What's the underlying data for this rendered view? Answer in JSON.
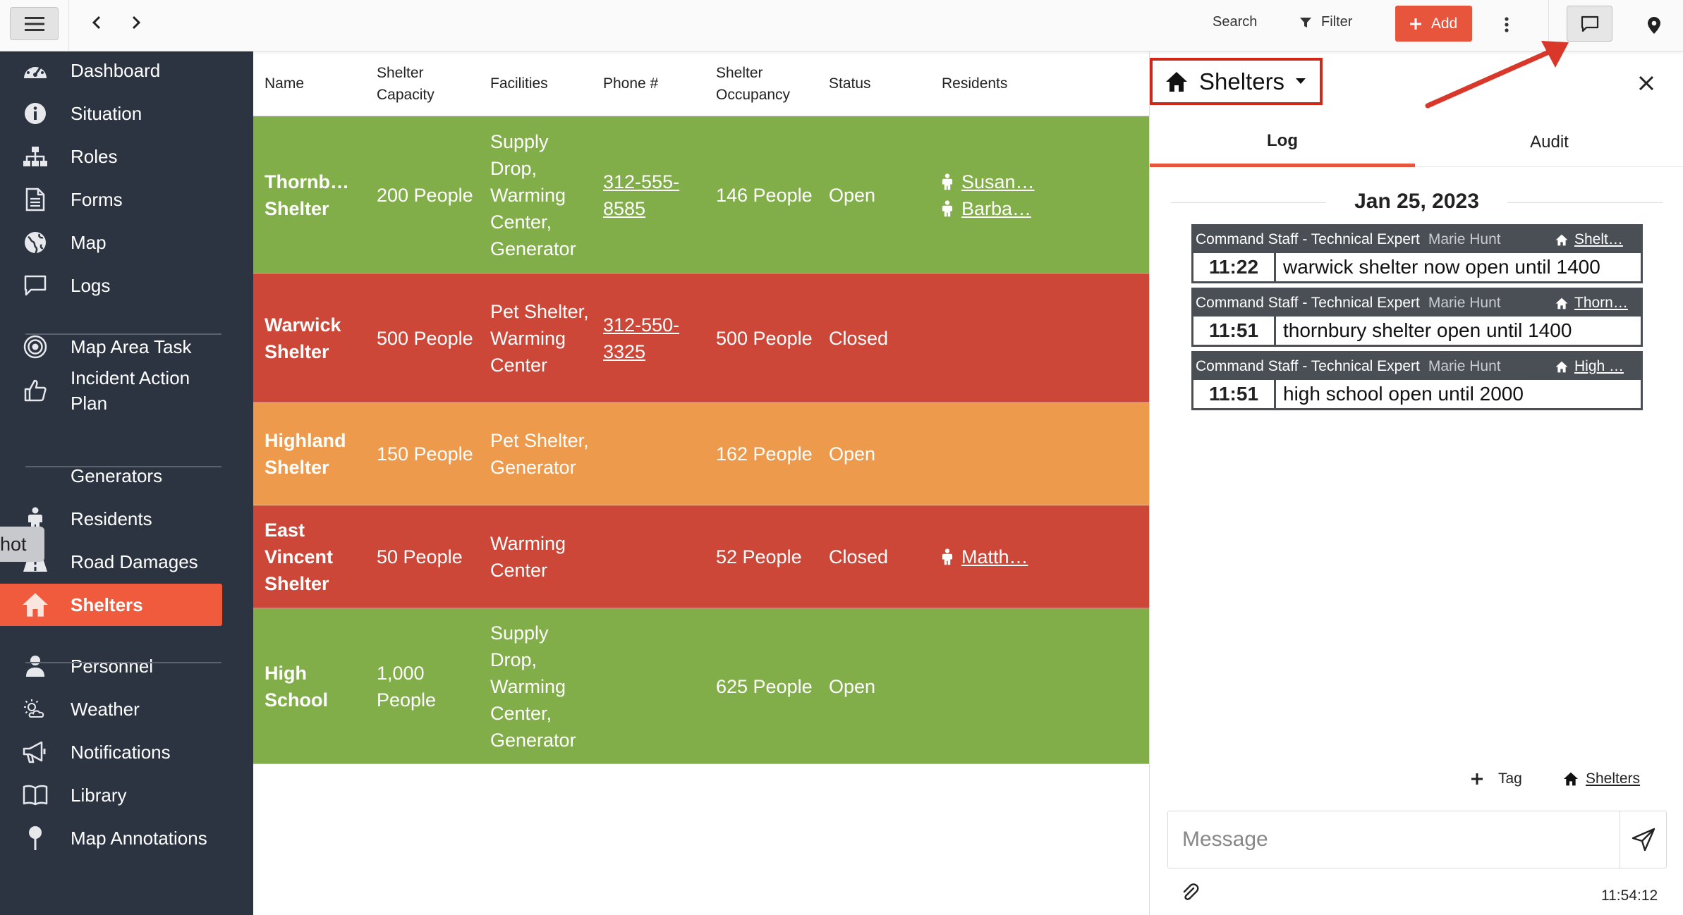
{
  "topbar": {
    "search_label": "Search",
    "filter_label": "Filter",
    "add_label": "Add"
  },
  "sidebar": {
    "items": [
      {
        "label": "Dashboard",
        "icon": "dashboard-icon"
      },
      {
        "label": "Situation",
        "icon": "info-icon"
      },
      {
        "label": "Roles",
        "icon": "org-chart-icon"
      },
      {
        "label": "Forms",
        "icon": "document-icon"
      },
      {
        "label": "Map",
        "icon": "globe-icon"
      },
      {
        "label": "Logs",
        "icon": "chat-icon"
      },
      {
        "label": "Map Area Task",
        "icon": "target-icon"
      },
      {
        "label": "Incident Action Plan",
        "icon": "thumbs-up-icon"
      },
      {
        "label": "Generators",
        "icon": "generator-icon"
      },
      {
        "label": "Residents",
        "icon": "person-icon"
      },
      {
        "label": "Road Damages",
        "icon": "road-icon"
      },
      {
        "label": "Shelters",
        "icon": "home-icon",
        "active": true
      },
      {
        "label": "Personnel",
        "icon": "user-icon"
      },
      {
        "label": "Weather",
        "icon": "weather-icon"
      },
      {
        "label": "Notifications",
        "icon": "megaphone-icon"
      },
      {
        "label": "Library",
        "icon": "book-icon"
      },
      {
        "label": "Map Annotations",
        "icon": "pin-icon"
      }
    ],
    "hot_tag": "hot"
  },
  "table": {
    "headers": [
      "Name",
      "Shelter Capacity",
      "Facilities",
      "Phone #",
      "Shelter Occupancy",
      "Status",
      "Residents"
    ],
    "rows": [
      {
        "name": "Thornb… Shelter",
        "capacity": "200 People",
        "facilities": "Supply Drop, Warming Center, Generator",
        "phone": "312-555-8585",
        "occupancy": "146 People",
        "status": "Open",
        "residents": [
          "Susan…",
          "Barba…"
        ],
        "color": "#82ae4a"
      },
      {
        "name": "Warwick Shelter",
        "capacity": "500 People",
        "facilities": "Pet Shelter, Warming Center",
        "phone": "312-550-3325",
        "occupancy": "500 People",
        "status": "Closed",
        "residents": [],
        "color": "#cd4739"
      },
      {
        "name": "Highland Shelter",
        "capacity": "150 People",
        "facilities": "Pet Shelter, Generator",
        "phone": "",
        "occupancy": "162 People",
        "status": "Open",
        "residents": [],
        "color": "#ee9a4d"
      },
      {
        "name": "East Vincent Shelter",
        "capacity": "50 People",
        "facilities": "Warming Center",
        "phone": "",
        "occupancy": "52 People",
        "status": "Closed",
        "residents": [
          "Matth…"
        ],
        "color": "#cd4739"
      },
      {
        "name": "High School",
        "capacity": "1,000 People",
        "facilities": "Supply Drop, Warming Center, Generator",
        "phone": "",
        "occupancy": "625 People",
        "status": "Open",
        "residents": [],
        "color": "#82ae4a"
      }
    ]
  },
  "panel": {
    "title": "Shelters",
    "tabs": [
      "Log",
      "Audit"
    ],
    "date": "Jan 25, 2023",
    "logs": [
      {
        "role": "Command Staff - Technical Expert",
        "author": "Marie Hunt",
        "tag": "Shelt…",
        "time": "11:22",
        "message": "warwick shelter now open until 1400"
      },
      {
        "role": "Command Staff - Technical Expert",
        "author": "Marie Hunt",
        "tag": "Thorn…",
        "time": "11:51",
        "message": "thornbury shelter open until 1400"
      },
      {
        "role": "Command Staff - Technical Expert",
        "author": "Marie Hunt",
        "tag": "High …",
        "time": "11:51",
        "message": "high school open until 2000"
      }
    ],
    "tag_button": "Tag",
    "current_tag": "Shelters",
    "message_placeholder": "Message",
    "clock": "11:54:12"
  }
}
